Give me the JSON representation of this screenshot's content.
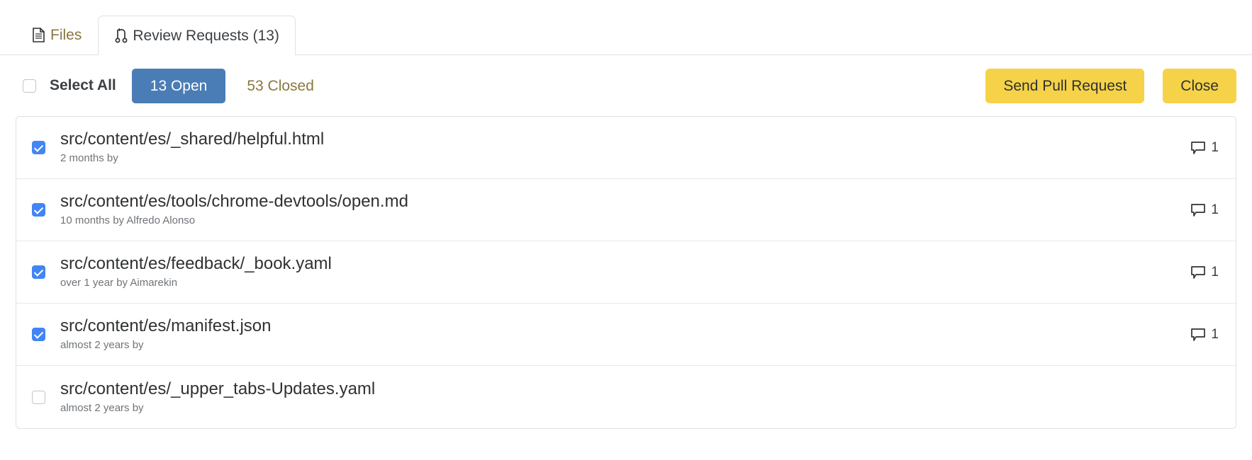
{
  "tabs": [
    {
      "id": "files",
      "label": "Files",
      "icon": "file-document-icon",
      "active": false
    },
    {
      "id": "review-requests",
      "label": "Review Requests (13)",
      "icon": "pull-request-icon",
      "active": true
    }
  ],
  "toolbar": {
    "select_all_label": "Select All",
    "select_all_checked": false,
    "filter_open_label": "13 Open",
    "filter_closed_label": "53 Closed",
    "send_pull_request_label": "Send Pull Request",
    "close_label": "Close"
  },
  "colors": {
    "accent_blue": "#4a7db5",
    "checkbox_blue": "#4285f4",
    "button_yellow": "#f6d248",
    "link_olive": "#8a7740",
    "border_grey": "#dfe1e3",
    "text_dark": "#2f3133",
    "text_muted": "#707478"
  },
  "rows": [
    {
      "title": "src/content/es/_shared/helpful.html",
      "meta": "2 months by",
      "checked": true,
      "comments": "1",
      "comment_icon": "comment-bubble-icon"
    },
    {
      "title": "src/content/es/tools/chrome-devtools/open.md",
      "meta": "10 months by Alfredo Alonso",
      "checked": true,
      "comments": "1",
      "comment_icon": "comment-bubble-icon"
    },
    {
      "title": "src/content/es/feedback/_book.yaml",
      "meta": "over 1 year by Aimarekin",
      "checked": true,
      "comments": "1",
      "comment_icon": "comment-bubble-icon"
    },
    {
      "title": "src/content/es/manifest.json",
      "meta": "almost 2 years by",
      "checked": true,
      "comments": "1",
      "comment_icon": "comment-bubble-icon"
    },
    {
      "title": "src/content/es/_upper_tabs-Updates.yaml",
      "meta": "almost 2 years by",
      "checked": false,
      "comments": "",
      "comment_icon": "comment-bubble-icon"
    }
  ]
}
